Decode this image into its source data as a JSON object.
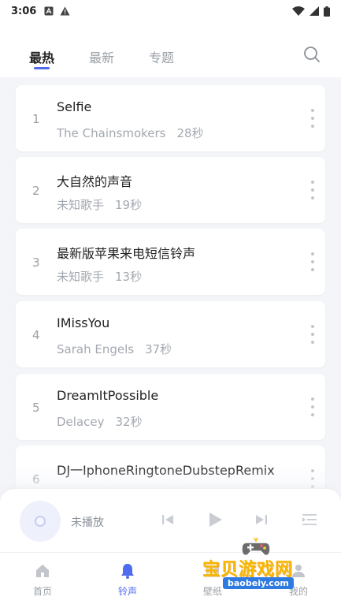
{
  "status_bar": {
    "time": "3:06"
  },
  "tabs": [
    {
      "label": "最热",
      "active": true
    },
    {
      "label": "最新",
      "active": false
    },
    {
      "label": "专题",
      "active": false
    }
  ],
  "songs": [
    {
      "index": "1",
      "title": "Selfie",
      "artist": "The Chainsmokers",
      "duration": "28秒"
    },
    {
      "index": "2",
      "title": "大自然的声音",
      "artist": "未知歌手",
      "duration": "19秒"
    },
    {
      "index": "3",
      "title": "最新版苹果来电短信铃声",
      "artist": "未知歌手",
      "duration": "13秒"
    },
    {
      "index": "4",
      "title": "IMissYou",
      "artist": "Sarah Engels",
      "duration": "37秒"
    },
    {
      "index": "5",
      "title": "DreamItPossible",
      "artist": "Delacey",
      "duration": "32秒"
    },
    {
      "index": "6",
      "title": "DJ一IphoneRingtoneDubstepRemix",
      "artist": "",
      "duration": ""
    }
  ],
  "player": {
    "status": "未播放"
  },
  "bottom_nav": [
    {
      "label": "首页",
      "active": false,
      "icon": "home-icon"
    },
    {
      "label": "铃声",
      "active": true,
      "icon": "bell-icon"
    },
    {
      "label": "壁纸",
      "active": false,
      "icon": "wallpaper-icon"
    },
    {
      "label": "我的",
      "active": false,
      "icon": "profile-icon"
    }
  ],
  "watermark": {
    "title": "宝贝游戏网",
    "url": "baobeiy.com"
  },
  "colors": {
    "accent": "#4f6cf0",
    "background": "#f4f5f9"
  }
}
